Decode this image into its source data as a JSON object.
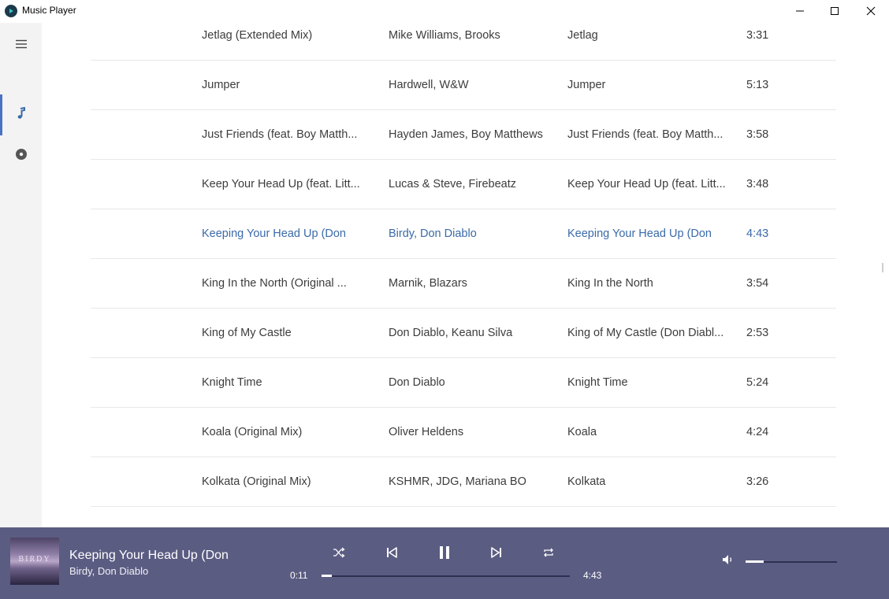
{
  "window": {
    "title": "Music Player"
  },
  "rail": {
    "items": [
      {
        "name": "menu",
        "icon": "hamburger-menu-icon"
      },
      {
        "name": "songs",
        "icon": "music-note-icon",
        "active": true
      },
      {
        "name": "albums",
        "icon": "disc-icon"
      }
    ]
  },
  "songs": [
    {
      "title": "Jetlag (Extended Mix)",
      "artist": "Mike Williams, Brooks",
      "album": "Jetlag",
      "duration": "3:31"
    },
    {
      "title": "Jumper",
      "artist": "Hardwell, W&W",
      "album": "Jumper",
      "duration": "5:13"
    },
    {
      "title": "Just Friends (feat. Boy Matth...",
      "artist": "Hayden James, Boy Matthews",
      "album": "Just Friends (feat. Boy Matth...",
      "duration": "3:58"
    },
    {
      "title": "Keep Your Head Up (feat. Litt...",
      "artist": "Lucas & Steve, Firebeatz",
      "album": "Keep Your Head Up (feat. Litt...",
      "duration": "3:48"
    },
    {
      "title": "Keeping Your Head Up (Don",
      "artist": "Birdy, Don Diablo",
      "album": "Keeping Your Head Up (Don",
      "duration": "4:43",
      "active": true
    },
    {
      "title": "King In the North (Original ...",
      "artist": "Marnik, Blazars",
      "album": "King In the North",
      "duration": "3:54"
    },
    {
      "title": "King of My Castle",
      "artist": "Don Diablo, Keanu Silva",
      "album": "King of My Castle (Don Diabl...",
      "duration": "2:53"
    },
    {
      "title": "Knight Time",
      "artist": "Don Diablo",
      "album": "Knight Time",
      "duration": "5:24"
    },
    {
      "title": "Koala (Original Mix)",
      "artist": "Oliver Heldens",
      "album": "Koala",
      "duration": "4:24"
    },
    {
      "title": "Kolkata (Original Mix)",
      "artist": "KSHMR, JDG, Mariana BO",
      "album": "Kolkata",
      "duration": "3:26"
    }
  ],
  "player": {
    "title": "Keeping Your Head Up (Don",
    "artist": "Birdy, Don Diablo",
    "cover_text": "BIRDY",
    "elapsed": "0:11",
    "total": "4:43",
    "progress_fraction": 0.04,
    "volume_fraction": 0.2
  },
  "colors": {
    "accent": "#3a6aa8",
    "player_bg": "#5b5c82",
    "rail_bg": "#f3f3f3"
  }
}
